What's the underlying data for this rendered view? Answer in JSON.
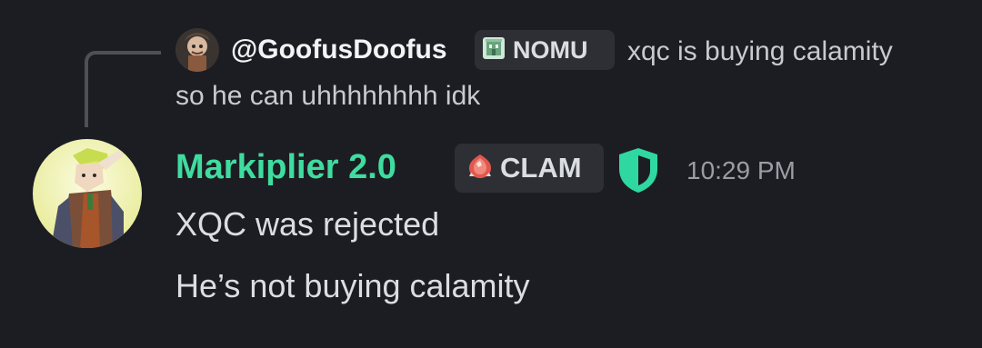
{
  "reply": {
    "username": "@GoofusDoofus",
    "tag_label": "NOMU",
    "tag_icon": "building-icon",
    "text_line1": "xqc is buying calamity",
    "text_line2": "so he can uhhhhhhhh idk"
  },
  "message": {
    "author": "Markiplier 2.0",
    "author_color": "#3fdca0",
    "tag_label": "CLAM",
    "tag_icon": "red-gem-icon",
    "badge_icon": "shield-icon",
    "timestamp": "10:29 PM",
    "lines": [
      "XQC was rejected",
      "He’s not buying calamity"
    ]
  }
}
